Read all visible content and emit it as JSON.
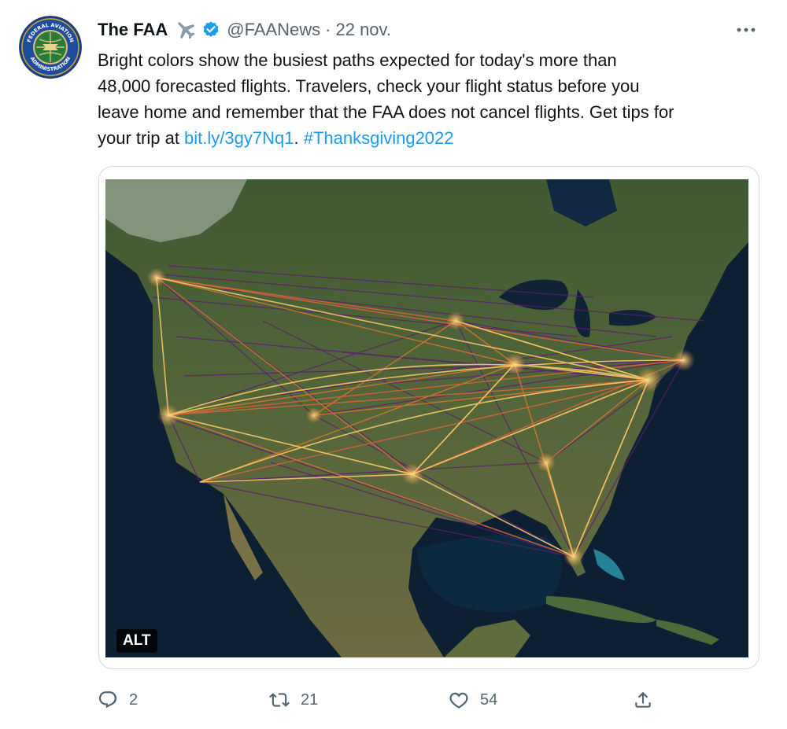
{
  "tweet": {
    "author_name": "The FAA",
    "author_handle": "@FAANews",
    "separator": "·",
    "date": "22 nov.",
    "text_lines": [
      "Bright colors show the busiest paths expected for today's more than",
      "48,000 forecasted flights. Travelers, check your flight status before you",
      "leave home and remember that the FAA does not cancel flights. Get tips for"
    ],
    "text_last_prefix": "your trip at ",
    "link_text": "bit.ly/3gy7Nq1",
    "link_suffix": ". ",
    "hashtag": "#Thanksgiving2022",
    "media_alt_badge": "ALT",
    "avatar_text": {
      "top": "FEDERAL AVIATION",
      "bottom": "ADMINISTRATION"
    }
  },
  "actions": {
    "replies": "2",
    "retweets": "21",
    "likes": "54"
  },
  "icons": {
    "avatar": "faa-seal-icon",
    "plane": "airplane-emoji-icon",
    "verified": "verified-badge-icon",
    "more": "more-options-icon",
    "reply": "reply-icon",
    "retweet": "retweet-icon",
    "like": "heart-icon",
    "share": "share-icon"
  },
  "colors": {
    "link": "#1d9bf0",
    "secondary_text": "#536471",
    "verified": "#1d9bf0"
  }
}
